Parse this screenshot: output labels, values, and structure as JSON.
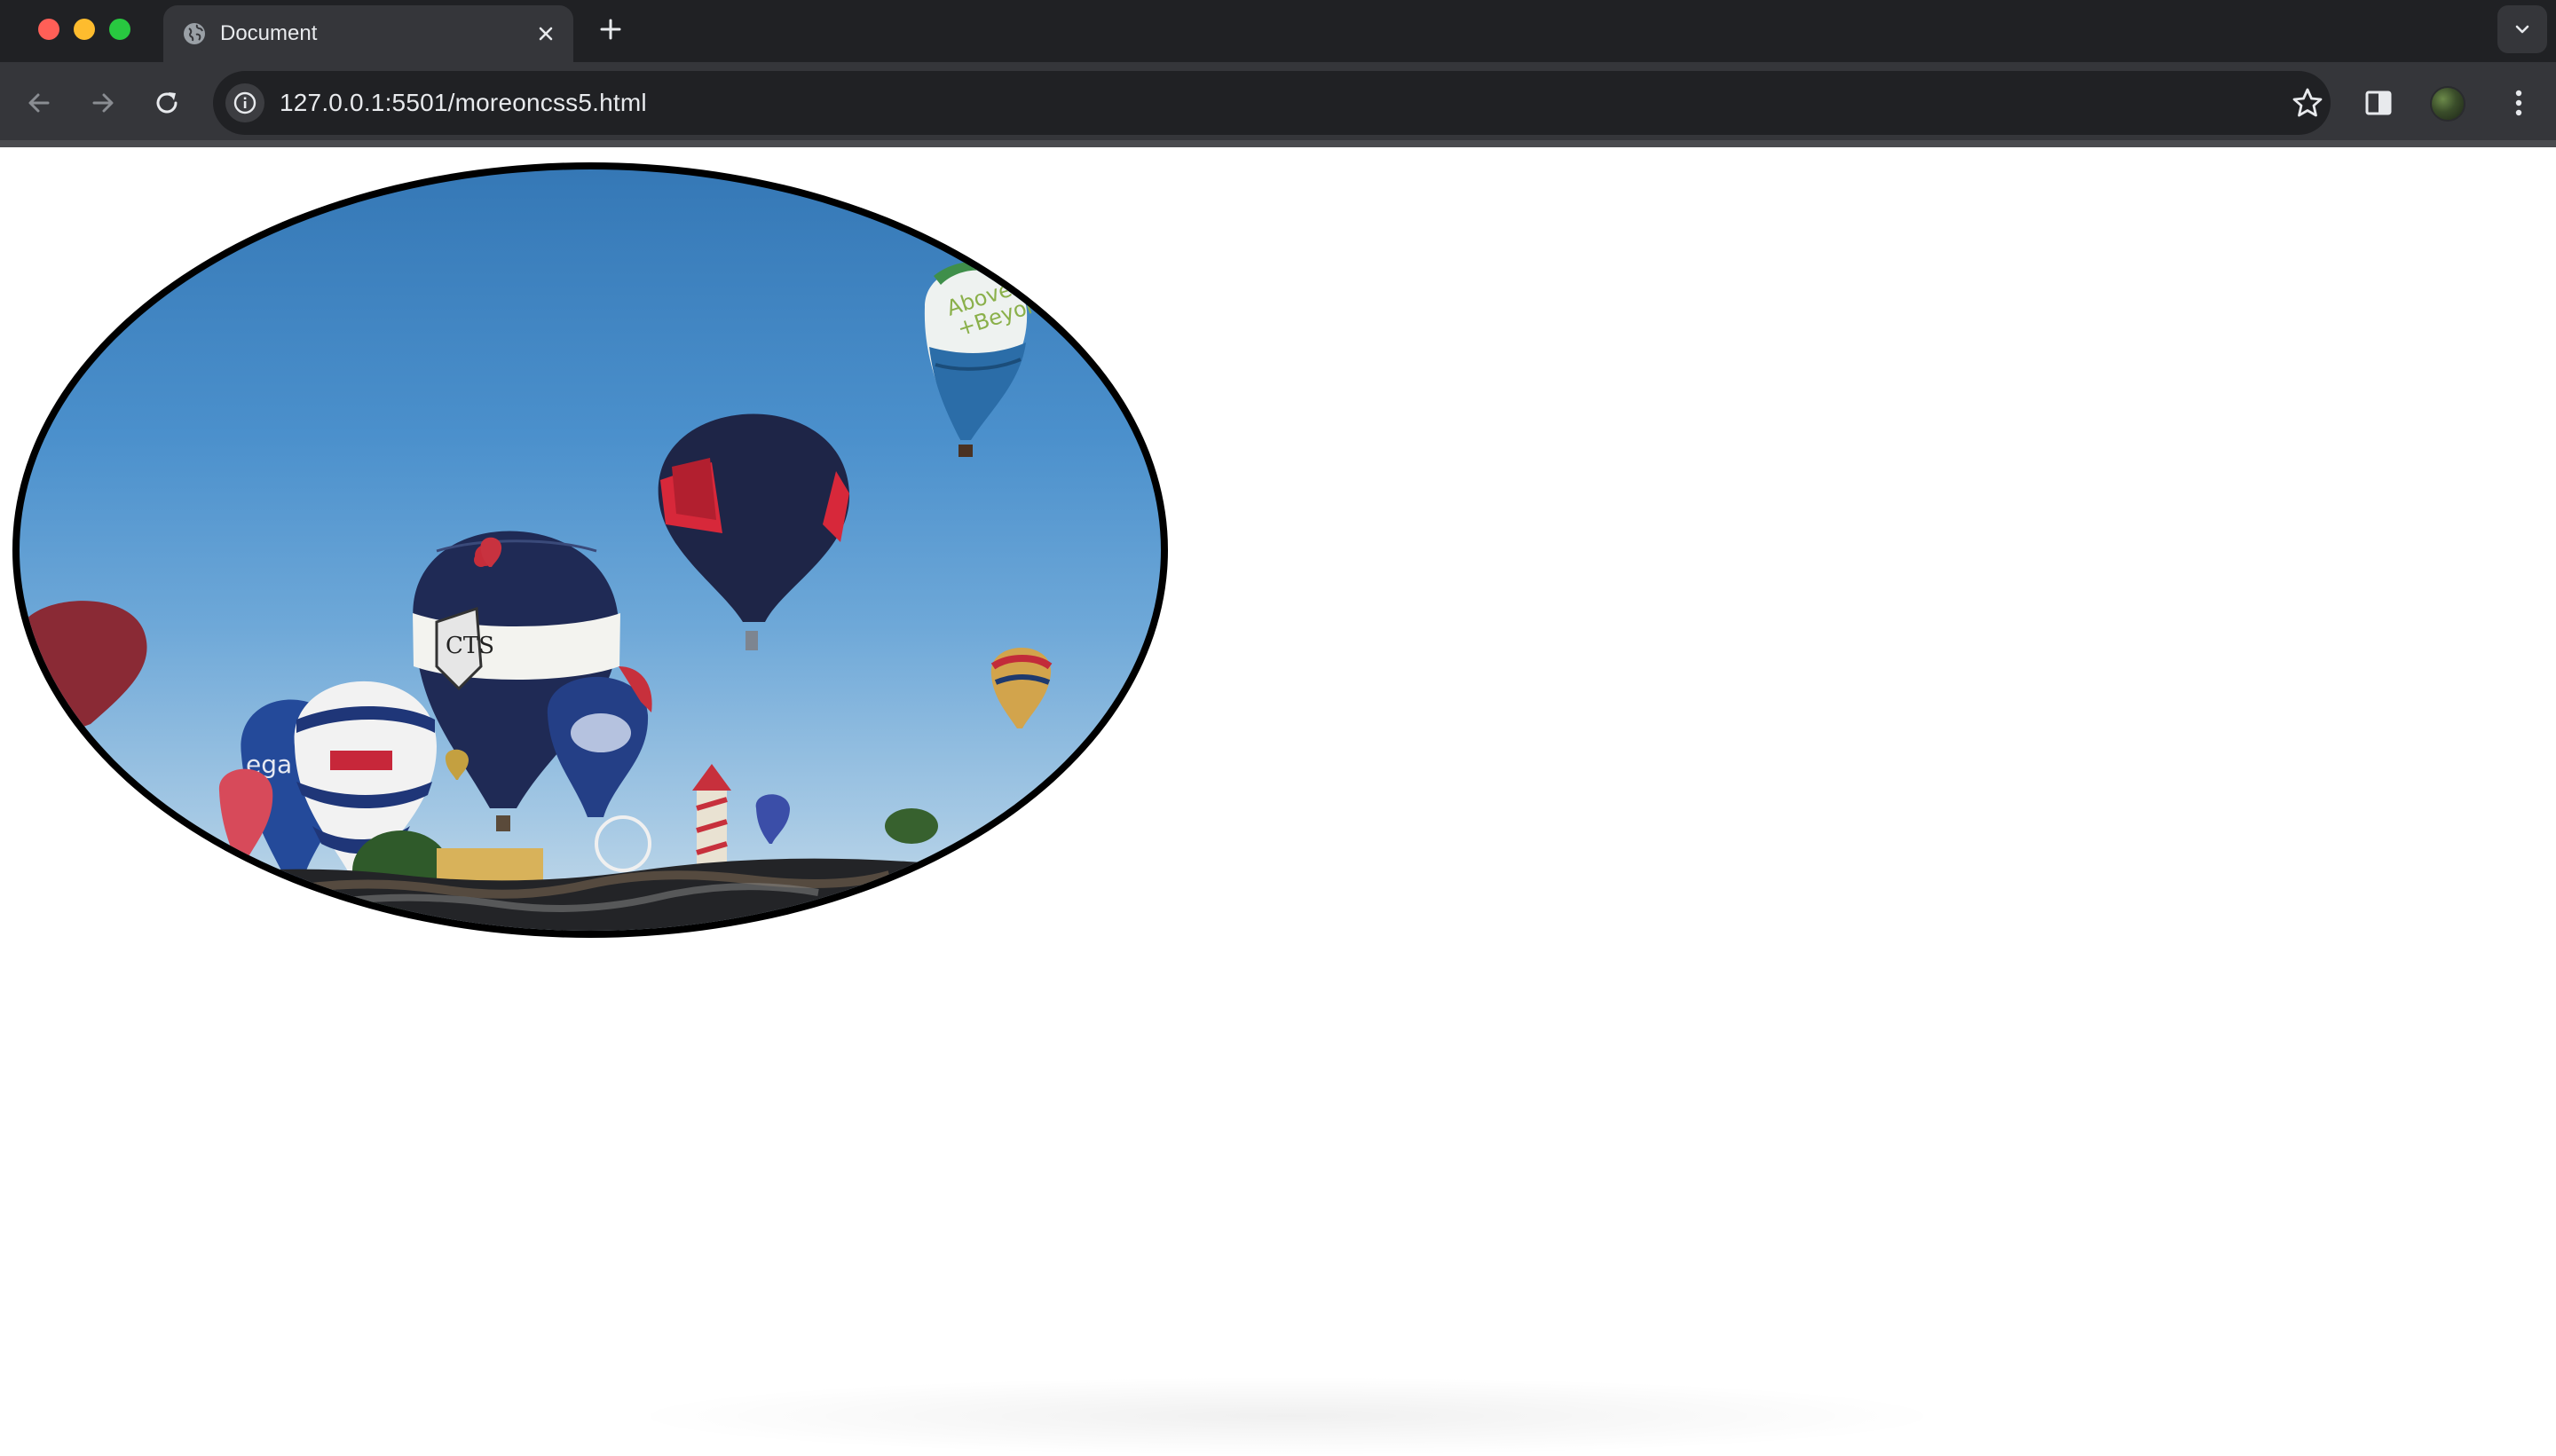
{
  "window": {
    "controls": [
      "close",
      "minimize",
      "zoom"
    ]
  },
  "tab": {
    "title": "Document",
    "favicon": "globe-icon"
  },
  "toolbar": {
    "url": "127.0.0.1:5501/moreoncss5.html",
    "bookmarked": false
  },
  "page": {
    "image": {
      "subject": "hot air balloons",
      "shape": "ellipse",
      "border_color": "#000000"
    }
  },
  "colors": {
    "tabstrip": "#202124",
    "toolbar": "#35363a",
    "omnibox": "#202124",
    "text": "#e8eaed",
    "sky_top": "#3578b6",
    "sky_bottom": "#c8dcea"
  }
}
